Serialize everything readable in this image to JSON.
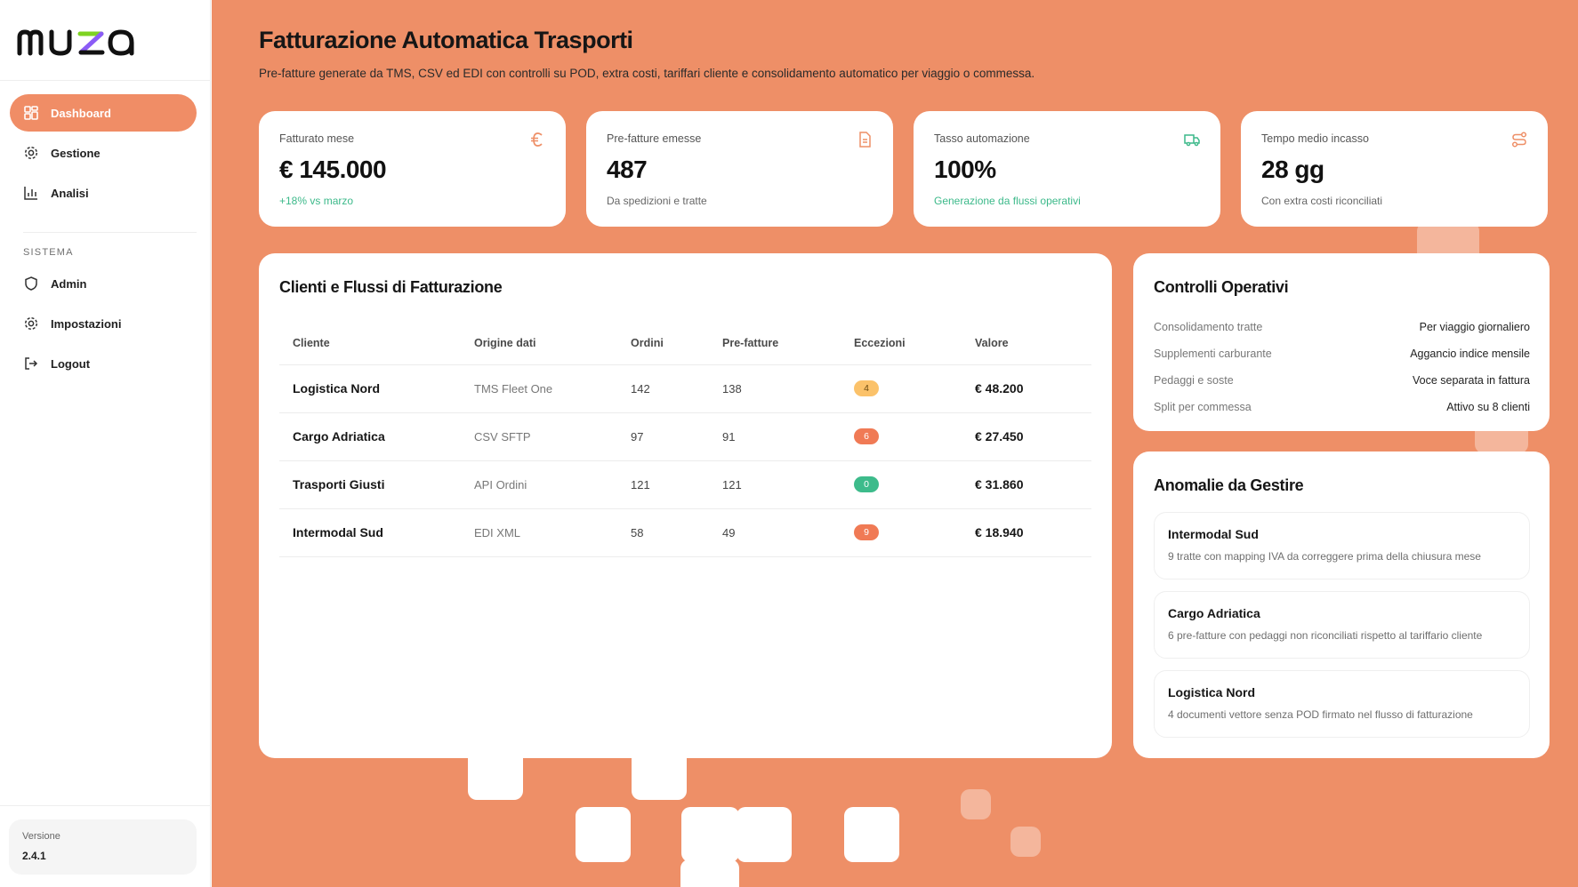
{
  "app": {
    "logo_text": "muza"
  },
  "sidebar": {
    "nav": [
      {
        "label": "Dashboard",
        "icon": "grid-icon",
        "active": true
      },
      {
        "label": "Gestione",
        "icon": "gear-icon"
      },
      {
        "label": "Analisi",
        "icon": "bar-chart-icon"
      }
    ],
    "section_label": "SISTEMA",
    "system_nav": [
      {
        "label": "Admin",
        "icon": "shield-icon"
      },
      {
        "label": "Impostazioni",
        "icon": "gear-icon"
      },
      {
        "label": "Logout",
        "icon": "logout-icon"
      }
    ],
    "version_label": "Versione",
    "version_value": "2.4.1"
  },
  "header": {
    "title": "Fatturazione Automatica Trasporti",
    "subtitle": "Pre-fatture generate da TMS, CSV ed EDI con controlli su POD, extra costi, tariffari cliente e consolidamento automatico per viaggio o commessa."
  },
  "kpis": [
    {
      "label": "Fatturato mese",
      "value": "€ 145.000",
      "note": "+18% vs marzo",
      "icon": "euro-icon"
    },
    {
      "label": "Pre-fatture emesse",
      "value": "487",
      "note": "Da spedizioni e tratte",
      "icon": "document-icon"
    },
    {
      "label": "Tasso automazione",
      "value": "100%",
      "note": "Generazione da flussi operativi",
      "icon": "truck-icon"
    },
    {
      "label": "Tempo medio incasso",
      "value": "28 gg",
      "note": "Con extra costi riconciliati",
      "icon": "route-icon"
    }
  ],
  "flows": {
    "title": "Clienti e Flussi di Fatturazione",
    "columns": [
      "Cliente",
      "Origine dati",
      "Ordini",
      "Pre-fatture",
      "Eccezioni",
      "Valore"
    ],
    "rows": [
      [
        "Logistica Nord",
        "TMS Fleet One",
        "142",
        "138",
        "4",
        "€ 48.200"
      ],
      [
        "Cargo Adriatica",
        "CSV SFTP",
        "97",
        "91",
        "6",
        "€ 27.450"
      ],
      [
        "Trasporti Giusti",
        "API Ordini",
        "121",
        "121",
        "0",
        "€ 31.860"
      ],
      [
        "Intermodal Sud",
        "EDI XML",
        "58",
        "49",
        "9",
        "€ 18.940"
      ]
    ],
    "badge_colors": [
      "#fbc26a",
      "#f07a55",
      "#3dbb8b",
      "#f07a55"
    ],
    "badge_text_colors": [
      "#6b4a10",
      "#ffffff",
      "#ffffff",
      "#ffffff"
    ]
  },
  "controls": {
    "title": "Controlli Operativi",
    "rows": [
      {
        "k": "Consolidamento tratte",
        "v": "Per viaggio giornaliero"
      },
      {
        "k": "Supplementi carburante",
        "v": "Aggancio indice mensile"
      },
      {
        "k": "Pedaggi e soste",
        "v": "Voce separata in fattura"
      },
      {
        "k": "Split per commessa",
        "v": "Attivo su 8 clienti"
      }
    ]
  },
  "anomalies": {
    "title": "Anomalie da Gestire",
    "items": [
      {
        "title": "Intermodal Sud",
        "desc": "9 tratte con mapping IVA da correggere prima della chiusura mese"
      },
      {
        "title": "Cargo Adriatica",
        "desc": "6 pre-fatture con pedaggi non riconciliati rispetto al tariffario cliente"
      },
      {
        "title": "Logistica Nord",
        "desc": "4 documenti vettore senza POD firmato nel flusso di fatturazione"
      }
    ]
  },
  "colors": {
    "accent": "#ee8f67",
    "positive": "#3cb98a",
    "logo_accent": "#7c3aed"
  }
}
